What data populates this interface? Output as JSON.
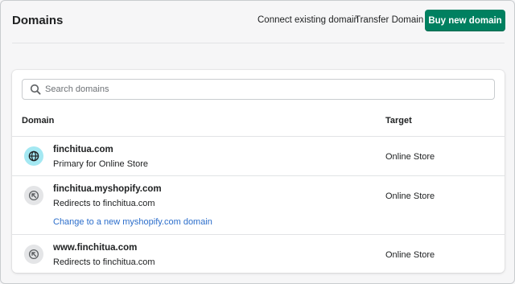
{
  "header": {
    "title": "Domains",
    "connect_label": "Connect existing domain",
    "transfer_label": "Transfer Domain",
    "buy_label": "Buy new domain"
  },
  "search": {
    "placeholder": "Search domains",
    "value": ""
  },
  "table": {
    "columns": [
      "Domain",
      "Target"
    ],
    "rows": [
      {
        "icon": "globe-icon",
        "name": "finchitua.com",
        "subtitle": "Primary for Online Store",
        "link": "",
        "target": "Online Store"
      },
      {
        "icon": "redirect-arrow-icon",
        "name": "finchitua.myshopify.com",
        "subtitle": "Redirects to finchitua.com",
        "link": "Change to a new myshopify.com domain",
        "target": "Online Store"
      },
      {
        "icon": "redirect-arrow-icon",
        "name": "www.finchitua.com",
        "subtitle": "Redirects to finchitua.com",
        "link": "",
        "target": "Online Store"
      }
    ]
  },
  "colors": {
    "primary_button": "#008060",
    "link": "#2c6ecb",
    "primary_icon_bg": "#a4e8f2",
    "redirect_icon_bg": "#e4e5e7"
  }
}
